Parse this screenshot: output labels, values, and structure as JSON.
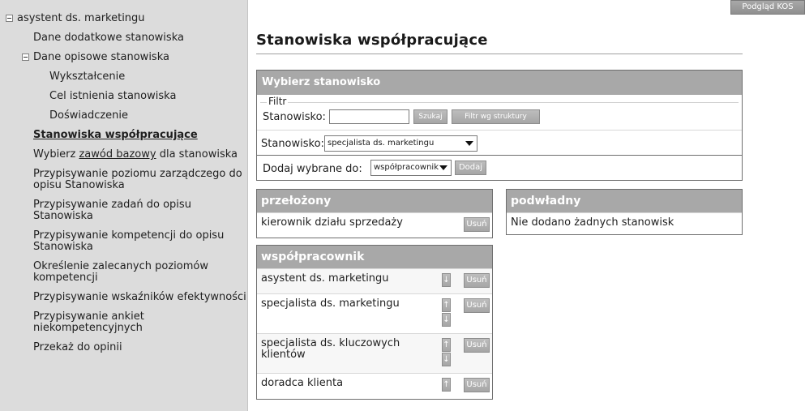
{
  "top_button": "Podgląd KOS",
  "sidebar": {
    "root": "asystent ds. marketingu",
    "items": [
      {
        "label": "Dane dodatkowe stanowiska"
      },
      {
        "label": "Dane opisowe stanowiska"
      },
      {
        "label": "Wykształcenie"
      },
      {
        "label": "Cel istnienia stanowiska"
      },
      {
        "label": "Doświadczenie"
      },
      {
        "label": "Stanowiska współpracujące"
      },
      {
        "label_pre": "Wybierz ",
        "label_link": "zawód bazowy",
        "label_post": " dla stanowiska"
      },
      {
        "label": "Przypisywanie poziomu zarządczego do opisu Stanowiska"
      },
      {
        "label": "Przypisywanie zadań do opisu Stanowiska"
      },
      {
        "label": "Przypisywanie kompetencji do opisu Stanowiska"
      },
      {
        "label": "Określenie zalecanych poziomów kompetencji"
      },
      {
        "label": "Przypisywanie wskaźników efektywności"
      },
      {
        "label": "Przypisywanie ankiet niekompetencyjnych"
      },
      {
        "label": "Przekaż do opinii"
      }
    ]
  },
  "main": {
    "title": "Stanowiska współpracujące",
    "select_panel": {
      "header": "Wybierz stanowisko",
      "filter_legend": "Filtr",
      "filter_label": "Stanowisko:",
      "filter_value": "",
      "search_button": "Szukaj",
      "structure_button": "Filtr wg struktury",
      "position_label": "Stanowisko:",
      "position_selected": "specjalista ds. marketingu",
      "add_label": "Dodaj wybrane do:",
      "add_selected": "współpracownik",
      "add_button": "Dodaj"
    },
    "superior": {
      "header": "przełożony",
      "rows": [
        {
          "name": "kierownik działu sprzedaży",
          "delete": "Usuń"
        }
      ]
    },
    "subordinate": {
      "header": "podwładny",
      "empty": "Nie dodano żadnych stanowisk"
    },
    "coworker": {
      "header": "współpracownik",
      "up_icon": "arrow-up-icon",
      "down_icon": "arrow-down-icon",
      "rows": [
        {
          "name": "asystent ds. marketingu",
          "delete": "Usuń"
        },
        {
          "name": "specjalista ds. marketingu",
          "delete": "Usuń"
        },
        {
          "name": "specjalista ds. kluczowych klientów",
          "delete": "Usuń"
        },
        {
          "name": "doradca klienta",
          "delete": "Usuń"
        }
      ]
    }
  }
}
